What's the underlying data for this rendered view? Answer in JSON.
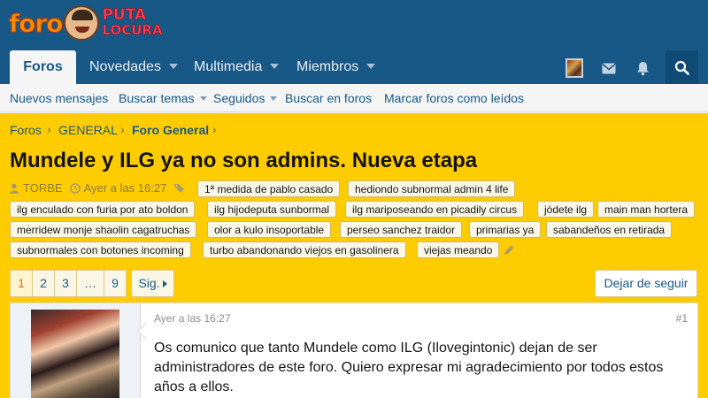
{
  "site": {
    "logo_word1": "foro",
    "logo_word2": "PUTA",
    "logo_word3": "LOCURA"
  },
  "nav": {
    "tabs": [
      {
        "label": "Foros",
        "active": true
      },
      {
        "label": "Novedades",
        "has_dropdown": true
      },
      {
        "label": "Multimedia",
        "has_dropdown": true
      },
      {
        "label": "Miembros",
        "has_dropdown": true
      }
    ],
    "icons": [
      "user-avatar-icon",
      "inbox-icon",
      "bell-icon",
      "search-icon"
    ]
  },
  "subnav": {
    "links": [
      {
        "label": "Nuevos mensajes"
      },
      {
        "label": "Buscar temas",
        "has_dropdown": true
      },
      {
        "label": "Seguidos",
        "has_dropdown": true
      },
      {
        "label": "Buscar en foros"
      },
      {
        "label": "Marcar foros como leídos"
      }
    ]
  },
  "breadcrumb": [
    "Foros",
    "GENERAL",
    "Foro General"
  ],
  "thread": {
    "title": "Mundele y ILG ya no son admins. Nueva etapa",
    "author": "TORBE",
    "date": "Ayer a las 16:27",
    "tags": [
      "1ª medida de pablo casado",
      "hediondo subnormal admin 4 life",
      "ilg enculado con furia por ato boldon",
      "ilg hijodeputa sunbormal",
      "ilg mariposeando en picadily circus",
      "jódete ilg",
      "main man hortera",
      "merridew monje shaolin cagatruchas",
      "olor a kulo insoportable",
      "perseo sanchez traidor",
      "primarias ya",
      "sabandeños en retirada",
      "subnormales con botones incoming",
      "turbo abandonando viejos en gasolinera",
      "viejas meando"
    ]
  },
  "pager": {
    "pages": [
      "1",
      "2",
      "3",
      "…",
      "9"
    ],
    "current": "1",
    "next_label": "Sig.",
    "follow_label": "Dejar de seguir"
  },
  "post": {
    "date": "Ayer a las 16:27",
    "number": "#1",
    "body": "Os comunico que tanto Mundele como ILG (Ilovegintonic) dejan de ser administradores de este foro. Quiero expresar mi agradecimiento por todos estos años a ellos."
  },
  "colors": {
    "header": "#185886",
    "accent_yellow": "#ffcc00",
    "link": "#185886"
  }
}
